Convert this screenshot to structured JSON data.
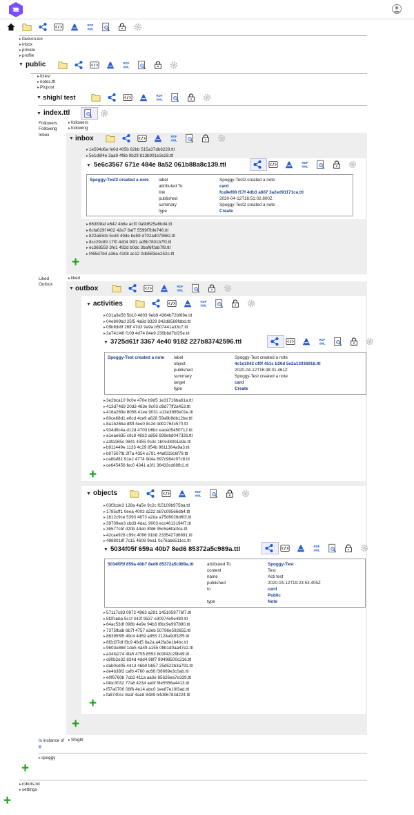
{
  "top_files": [
    "favicon.ico",
    "inbox",
    "private",
    "profile"
  ],
  "public": {
    "title": "public",
    "files": [
      "fctest",
      "notes.ttl",
      "Picpost"
    ],
    "shighl": {
      "title": "shighl test",
      "index": {
        "title": "index.ttl",
        "rows": [
          {
            "label": "Followers",
            "value": "followers"
          },
          {
            "label": "Following",
            "value": "following"
          },
          {
            "label": "Inbox",
            "value": ""
          }
        ],
        "inbox": {
          "title": "inbox",
          "files_before": [
            "1e594d6a fe0d 405b 82bb 515a37db6228.ttl",
            "5e1d6f4e 3aa9 4f6b 9b29 813b901e3e28.ttl"
          ],
          "item": {
            "title": "5e6c3567 671e 484e 8a52 061b88a8c139.ttl",
            "subject": "Spoggy-Test2 created a note",
            "props": [
              {
                "k": "label",
                "v": "Spoggy-Test2 created a note",
                "link": false
              },
              {
                "k": "attributed To",
                "v": "card",
                "link": true
              },
              {
                "k": "link",
                "v": "fca9ef08 f17f 4db3 a607 3a2ed91171ca.ttl",
                "link": true
              },
              {
                "k": "published",
                "v": "2020-04-12T16:51:02.800Z",
                "link": false
              },
              {
                "k": "summary",
                "v": "Spoggy-Test2 created a note",
                "link": false
              },
              {
                "k": "type",
                "v": "Create",
                "link": true
              }
            ]
          },
          "files_after": [
            "663f08af e642 4b8e acf0 0a9d625a6bd4.ttl",
            "6cfa029f f402 42e7 8af7 5599f7bfe746.ttl",
            "822a63cb 5cd4 49de be59 d702ad079662.ttl",
            "8cc29c89 17f0 4d04 90f1 ad5b7801b7f0.ttl",
            "ec368559 3fe1 492d b0dc 3baf6f0ab7f8.ttl",
            "f465d7b4 a36a 4108 ac12 0db583ee252c.ttl"
          ]
        },
        "liked_label": "Liked",
        "liked_value": "liked",
        "outbox_label": "Outbox",
        "outbox": {
          "title": "outbox",
          "activities": {
            "title": "activities",
            "files_before": [
              "031a3e56 5b10 4803 9eb9 4364b72bf69e.ttl",
              "04e809bd 25f5 4a8d 8329 842d8569fdbd.ttl",
              "09bfbb8f 26ff 47d3 9a9a b507441a33c7.ttl",
              "2e741f40 f109 4d74 84e9 230bbd7bf25e.ttl"
            ],
            "item": {
              "title": "3725d61f 3367 4e40 9182 227b83742596.ttl",
              "subject": "Spoggy-Test created a note",
              "props": [
                {
                  "k": "label",
                  "v": "Spoggy-Test created a note",
                  "link": false
                },
                {
                  "k": "object",
                  "v": "4c1e1042 cf0f 451c b20d 5e2a13036916.ttl",
                  "link": true
                },
                {
                  "k": "published",
                  "v": "2020-04-12T16:48:01.461Z",
                  "link": false
                },
                {
                  "k": "summary",
                  "v": "Spoggy-Test created a note",
                  "link": false
                },
                {
                  "k": "target",
                  "v": "card",
                  "link": true
                },
                {
                  "k": "type",
                  "v": "Create",
                  "link": true
                }
              ]
            },
            "files_after": [
              "3e2bca10 9c0e 470e b9d5 1e31716ba61a.ttl",
              "413d7469 20d3 483e 9c03 d9d77ff2a453.ttl",
              "416a269e 8058 41ee 9031 a13e3885e01e.ttl",
              "80ce68d1 e6cd 4ce9 a628 59a9b9db12be.ttl",
              "8a1b26ba df9f 4ee0 8c2d dd02764c570.ttl",
              "934d9c4a d12d 4703 b6bc eaced5450712.ttl",
              "a1eae635 c0c8 4833 a856 699ebd047326.ttl",
              "a3fa165c 0841 4355 9c3c 1b0c480b1e9e.ttl",
              "b911449e 1133 4c29 854b 9611364a9a3.ttl",
              "b97507f8 2f7a 4354 a791 44af219c6f79.ttl",
              "ca8faf81 91e2 4774 9d4a 697c984c97c8.ttl",
              "ce645456 fec0 4341 a3f1 36433cd88fb1.ttl"
            ]
          },
          "objects": {
            "title": "objects",
            "files_before": [
              "03f3cde3 128a 4a5e 9c2c f15109b975ba.ttl",
              "1785cff1 0eea 4003 a222 b87c09566db4.ttl",
              "1812c9ce 5393 4873 a2da a75d6028d6f3.ttl",
              "39709ee3 cbd3 4da1 9003 ecc4613194f7.ttl",
              "3b577cbf d20b 44eb 8fd6 95c5a6facfca.ttl",
              "42cae928 c99c 4096 91b8 2335427d6891.ttl",
              "4988018f 7c15 4608 9ea1 0c76ab6511cc.ttl"
            ],
            "item": {
              "title": "5034f05f 659a 40b7 8ed6 85372a5c989a.ttl",
              "subject": "5034f05f 659a 40b7 8ed6 85372a5c989a.ttl",
              "props": [
                {
                  "k": "attributed To",
                  "v": "Spoggy-Test",
                  "link": true
                },
                {
                  "k": "content",
                  "v": "Test",
                  "link": false
                },
                {
                  "k": "name",
                  "v": "Acti test",
                  "link": false
                },
                {
                  "k": "published",
                  "v": "2020-04-12T19:23:53.405Z",
                  "link": false
                },
                {
                  "k": "to",
                  "v": "card",
                  "link": true
                },
                {
                  "k": "",
                  "v": "Public",
                  "link": true
                },
                {
                  "k": "type",
                  "v": "Note",
                  "link": true
                }
              ]
            },
            "files_after": [
              "57117c83 0972 4963 a291 1451059776f7.ttl",
              "5f2fceba 5c1f 442f 9537 e30974e9e480.ttl",
              "64ac53df 098b 4e9e 94b3 f8bc9e997890.ttl",
              "7375fbab 6b7f 4757 a3eb 50796e592655.ttl",
              "86395f95 49c4 4d59 a855 2124a9df32f5.ttl",
              "8f2d37df f3c9 46d5 8a2a a42fa3e1b4bc.ttl",
              "9603e868 1de5 4a49 a155 08b1d0aa47e2.ttl",
              "a34fa274 4fa5 4755 8553 8d3f42c29b49.ttl",
              "c80b2e32 834d 4dd4 98f7 99498500c216.ttl",
              "dab0cd05 4413 46b0 bb57 25d522b3a791.ttl",
              "de4b38f2 cafb 4760 ac66 f38669e3c0ab.ttl",
              "e0f6760b 7cb3 411a aa3e 85626ea7e339.ttl",
              "f4bc3032 77a8 4234 aebf f8e5556a4413.ttl",
              "f57a0700 08f6 4e14 abc0 1ee87e10f3ad.ttl",
              "fa8740cc 8eaf 4ae8 8489 b4d96783d224.ttl"
            ]
          }
        }
      },
      "instance_label": "Is instance of",
      "instance_value": "Shighl",
      "spoggy": "spoggy"
    }
  },
  "bottom_files": [
    "robots.txt",
    "settings"
  ],
  "icon_names": [
    "home-icon",
    "folder-icon",
    "share-icon",
    "code-icon",
    "edit-icon",
    "rdf-xml-icon",
    "search-icon",
    "lock-icon",
    "gear-icon"
  ]
}
